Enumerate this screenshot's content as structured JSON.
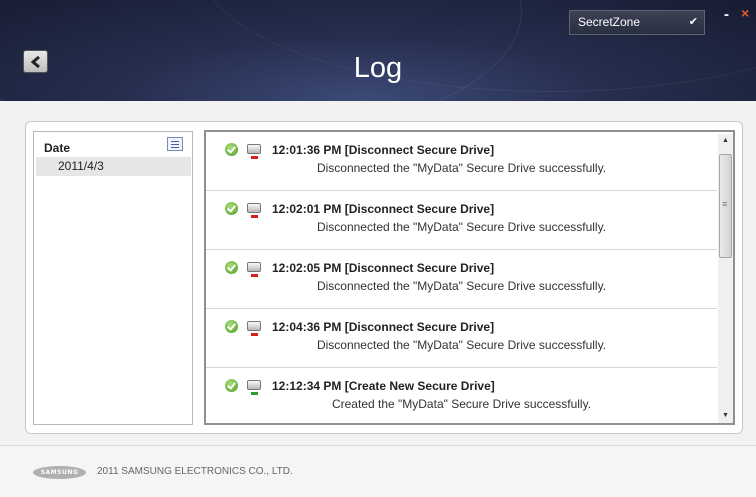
{
  "header": {
    "title": "Log",
    "zone_select": "SecretZone",
    "back_icon": "back-arrow-icon"
  },
  "date_panel": {
    "header": "Date",
    "items": [
      "2011/4/3"
    ]
  },
  "log_entries": [
    {
      "title": "12:01:36 PM [Disconnect Secure Drive]",
      "description": "Disconnected the \"MyData\" Secure Drive successfully.",
      "status_icon": "check-icon",
      "drive_icon": "drive-disconnect-icon"
    },
    {
      "title": "12:02:01 PM [Disconnect Secure Drive]",
      "description": "Disconnected the \"MyData\" Secure Drive successfully.",
      "status_icon": "check-icon",
      "drive_icon": "drive-disconnect-icon"
    },
    {
      "title": "12:02:05 PM [Disconnect Secure Drive]",
      "description": "Disconnected the \"MyData\" Secure Drive successfully.",
      "status_icon": "check-icon",
      "drive_icon": "drive-disconnect-icon"
    },
    {
      "title": "12:04:36 PM [Disconnect Secure Drive]",
      "description": "Disconnected the \"MyData\" Secure Drive successfully.",
      "status_icon": "check-icon",
      "drive_icon": "drive-disconnect-icon"
    },
    {
      "title": "12:12:34 PM [Create New Secure Drive]",
      "description": "Created the \"MyData\" Secure Drive successfully.",
      "status_icon": "check-icon",
      "drive_icon": "drive-create-icon"
    }
  ],
  "footer": {
    "logo_text": "SAMSUNG",
    "copyright": "2011 SAMSUNG ELECTRONICS CO., LTD."
  }
}
